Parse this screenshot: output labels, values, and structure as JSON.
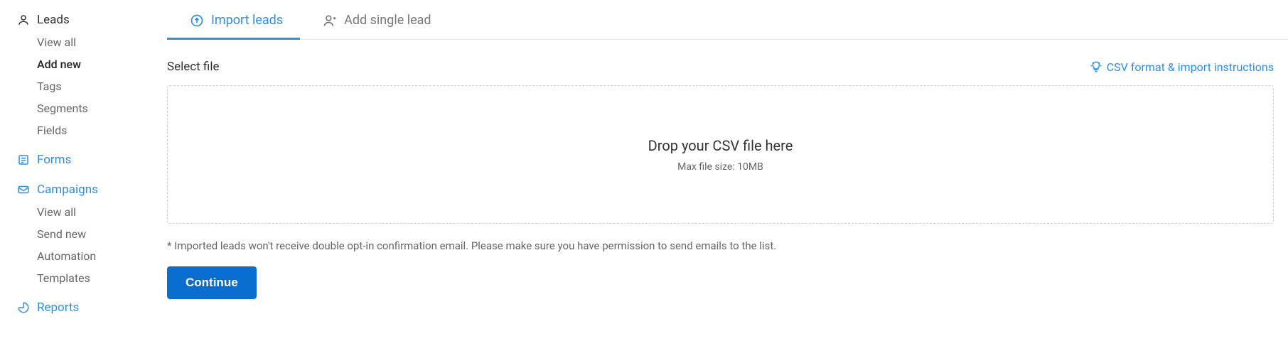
{
  "sidebar": {
    "sections": [
      {
        "key": "leads",
        "label": "Leads",
        "link": false,
        "items": [
          {
            "label": "View all",
            "active": false
          },
          {
            "label": "Add new",
            "active": true
          },
          {
            "label": "Tags",
            "active": false
          },
          {
            "label": "Segments",
            "active": false
          },
          {
            "label": "Fields",
            "active": false
          }
        ]
      },
      {
        "key": "forms",
        "label": "Forms",
        "link": true,
        "items": []
      },
      {
        "key": "campaigns",
        "label": "Campaigns",
        "link": true,
        "items": [
          {
            "label": "View all",
            "active": false
          },
          {
            "label": "Send new",
            "active": false
          },
          {
            "label": "Automation",
            "active": false
          },
          {
            "label": "Templates",
            "active": false
          }
        ]
      },
      {
        "key": "reports",
        "label": "Reports",
        "link": true,
        "items": []
      }
    ]
  },
  "tabs": [
    {
      "key": "import",
      "label": "Import leads",
      "active": true
    },
    {
      "key": "single",
      "label": "Add single lead",
      "active": false
    }
  ],
  "main": {
    "section_title": "Select file",
    "help_link": "CSV format & import instructions",
    "dropzone_title": "Drop your CSV file here",
    "dropzone_sub": "Max file size: 10MB",
    "note": "* Imported leads won't receive double opt-in confirmation email. Please make sure you have permission to send emails to the list.",
    "continue": "Continue"
  }
}
